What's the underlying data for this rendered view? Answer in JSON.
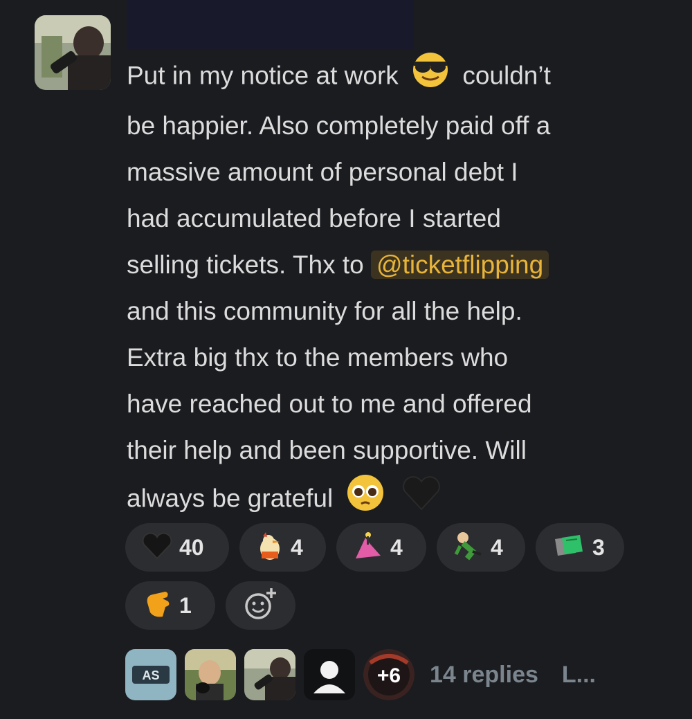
{
  "message": {
    "lines": [
      {
        "before": "Put in my notice at work",
        "after": "couldn’t"
      },
      {
        "text": "be happier. Also completely paid off a"
      },
      {
        "text": "massive amount of personal debt I"
      },
      {
        "text": "had accumulated before I started"
      },
      {
        "before": "selling tickets. Thx to",
        "mention": "@ticketflipping"
      },
      {
        "text": "and this community for all the help."
      },
      {
        "text": "Extra big thx to the members who"
      },
      {
        "text": "have reached out to me and offered"
      },
      {
        "text": "their help and been supportive. Will"
      },
      {
        "before": "always be grateful"
      }
    ],
    "inline_emojis": [
      "sunglasses-emoji",
      "pleading-face-emoji",
      "black-heart-emoji"
    ]
  },
  "reactions": [
    {
      "icon": "black-heart-icon",
      "count": "40"
    },
    {
      "icon": "chicken-emoji-icon",
      "count": "4"
    },
    {
      "icon": "pink-creature-emoji-icon",
      "count": "4"
    },
    {
      "icon": "running-guy-emoji-icon",
      "count": "4"
    },
    {
      "icon": "money-stack-emoji-icon",
      "count": "3"
    },
    {
      "icon": "waving-hand-emoji-icon",
      "count": "1"
    }
  ],
  "add_reaction": {
    "icon": "add-emoji-icon"
  },
  "thread": {
    "avatar_logo_text": "AS",
    "more_count": "+6",
    "replies": "14 replies",
    "last_reply": "L..."
  }
}
